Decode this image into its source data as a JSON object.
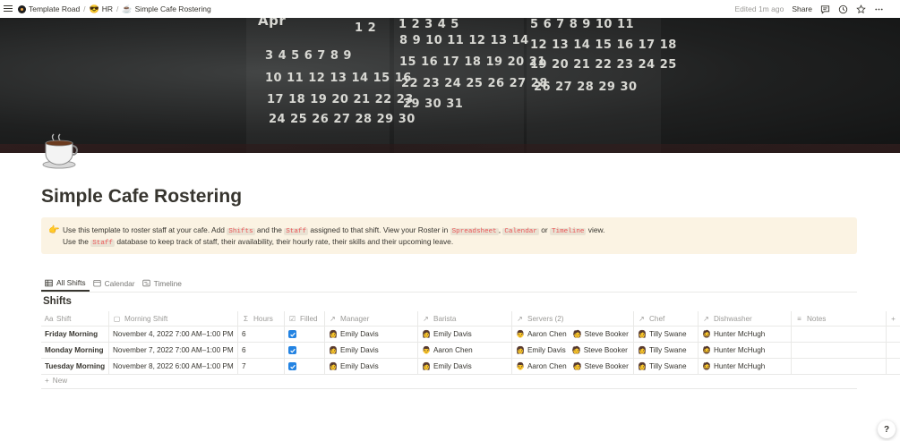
{
  "breadcrumbs": [
    {
      "icon": "template-road-logo",
      "label": "Template Road"
    },
    {
      "icon": "😎",
      "label": "HR"
    },
    {
      "icon": "☕",
      "label": "Simple Cafe Rostering"
    }
  ],
  "topbar": {
    "edited": "Edited 1m ago",
    "share": "Share"
  },
  "cover": {
    "month": "Apr",
    "rows": [
      [
        "1 2",
        "1 2 3 4 5",
        "5 6 7 8 9 10 11"
      ],
      [
        "3 4 5 6 7 8 9",
        "8 9 10 11 12 13 14",
        "12 13 14 15 16 17 18"
      ],
      [
        "10 11 12 13 14 15 16",
        "15 16 17 18 19 20 21",
        "19 20 21 22 23 24 25"
      ],
      [
        "17 18 19 20 21 22 23",
        "22 23 24 25 26 27 28",
        "26 27 28 29 30"
      ],
      [
        "24 25 26 27 28 29 30",
        "29 30 31",
        ""
      ]
    ]
  },
  "page_icon": "coffee-cup",
  "title": "Simple Cafe Rostering",
  "callout": {
    "icon": "👉",
    "l1_a": "Use this template to roster staff at your cafe. Add ",
    "code_shifts": "Shifts",
    "l1_b": " and the ",
    "code_staff": "Staff",
    "l1_c": " assigned to that shift. View your Roster in ",
    "code_spreadsheet": "Spreadsheet",
    "l1_d": ", ",
    "code_calendar": "Calendar",
    "l1_e": " or ",
    "code_timeline": "Timeline",
    "l1_f": " view.",
    "l2_a": "Use the ",
    "code_staff2": "Staff",
    "l2_b": " database to keep track of staff, their availability, their hourly rate, their skills and their upcoming leave."
  },
  "tabs": [
    {
      "label": "All Shifts",
      "icon": "table-icon",
      "active": true
    },
    {
      "label": "Calendar",
      "icon": "calendar-icon",
      "active": false
    },
    {
      "label": "Timeline",
      "icon": "timeline-icon",
      "active": false
    }
  ],
  "database_title": "Shifts",
  "columns": {
    "shift": "Shift",
    "date": "Morning Shift",
    "hours": "Hours",
    "filled": "Filled",
    "manager": "Manager",
    "barista": "Barista",
    "servers": "Servers (2)",
    "chef": "Chef",
    "dishwasher": "Dishwasher",
    "notes": "Notes"
  },
  "rows": [
    {
      "shift": "Friday Morning",
      "date": "November 4, 2022 7:00 AM–1:00 PM",
      "hours": "6",
      "filled": true,
      "manager": "Emily Davis",
      "barista": "Emily Davis",
      "server1": "Aaron Chen",
      "server2": "Steve Booker",
      "chef": "Tilly Swane",
      "dishwasher": "Hunter McHugh",
      "notes": ""
    },
    {
      "shift": "Monday Morning",
      "date": "November 7, 2022 7:00 AM–1:00 PM",
      "hours": "6",
      "filled": true,
      "manager": "Emily Davis",
      "barista": "Aaron Chen",
      "server1": "Emily Davis",
      "server2": "Steve Booker",
      "chef": "Tilly Swane",
      "dishwasher": "Hunter McHugh",
      "notes": ""
    },
    {
      "shift": "Tuesday Morning",
      "date": "November 8, 2022 6:00 AM–1:00 PM",
      "hours": "7",
      "filled": true,
      "manager": "Emily Davis",
      "barista": "Emily Davis",
      "server1": "Aaron Chen",
      "server2": "Steve Booker",
      "chef": "Tilly Swane",
      "dishwasher": "Hunter McHugh",
      "notes": ""
    }
  ],
  "avatars": {
    "Emily Davis": "👩",
    "Aaron Chen": "👨",
    "Steve Booker": "🧑",
    "Tilly Swane": "👩",
    "Hunter McHugh": "🧔"
  },
  "new_label": "New",
  "help": "?",
  "colors": {
    "accent": "#2383e2",
    "callout_bg": "#fbf3e3",
    "code": "#eb5757",
    "text": "#37352f"
  }
}
